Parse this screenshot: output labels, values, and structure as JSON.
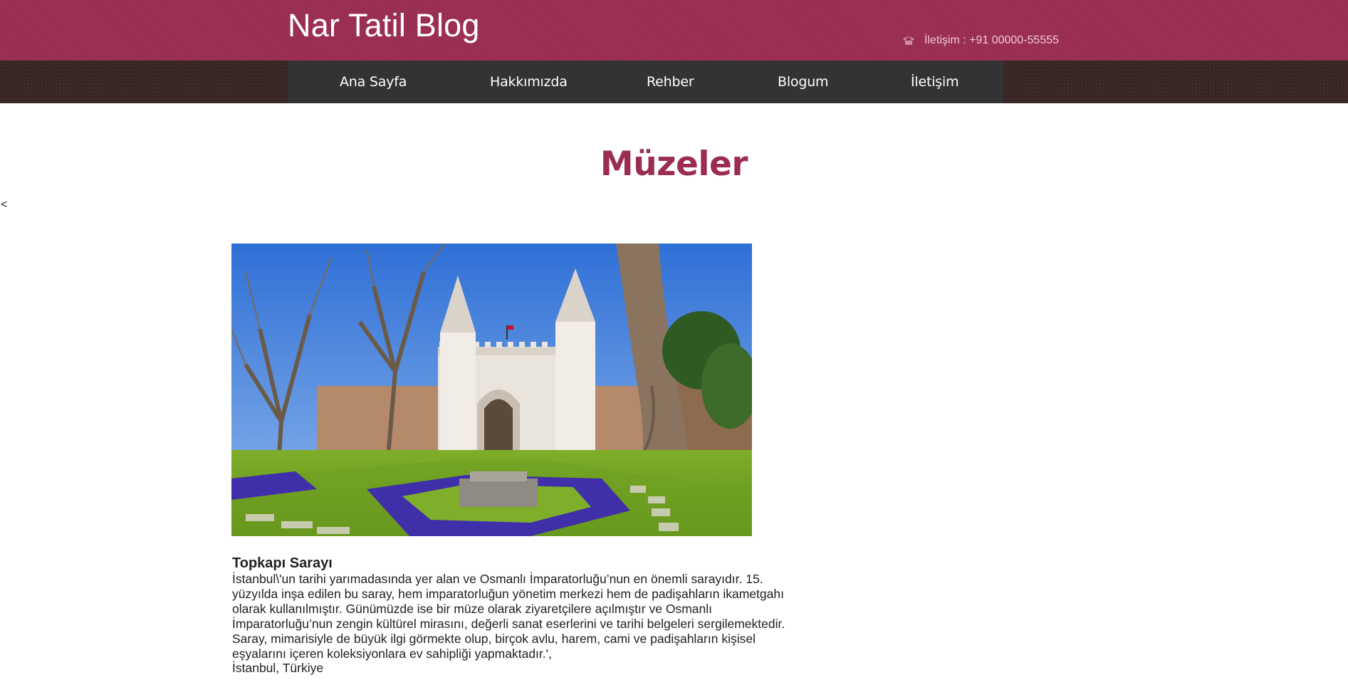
{
  "header": {
    "site_title": "Nar Tatil Blog",
    "contact_text": "İletişim : +91 00000-55555",
    "phone_icon": "phone-icon"
  },
  "nav": {
    "items": [
      {
        "label": "Ana Sayfa"
      },
      {
        "label": "Hakkımızda"
      },
      {
        "label": "Rehber"
      },
      {
        "label": "Blogum"
      },
      {
        "label": "İletişim"
      }
    ]
  },
  "main": {
    "heading": "Müzeler",
    "stray_char": "<",
    "museum": {
      "title": "Topkapı Sarayı",
      "description": "İstanbul\\'un tarihi yarımadasında yer alan ve Osmanlı İmparatorluğu’nun en önemli sarayıdır. 15. yüzyılda inşa edilen bu saray, hem imparatorluğun yönetim merkezi hem de padişahların ikametgahı olarak kullanılmıştır. Günümüzde ise bir müze olarak ziyaretçilere açılmıştır ve Osmanlı İmparatorluğu’nun zengin kültürel mirasını, değerli sanat eserlerini ve tarihi belgeleri sergilemektedir. Saray, mimarisiyle de büyük ilgi görmekte olup, birçok avlu, harem, cami ve padişahların kişisel eşyalarını içeren koleksiyonlara ev sahipliği yapmaktadır.',",
      "location": "İstanbul, Türkiye"
    }
  },
  "colors": {
    "brand": "#9b2d52",
    "nav_bg": "#333333",
    "nav_strip": "#3a2726"
  }
}
